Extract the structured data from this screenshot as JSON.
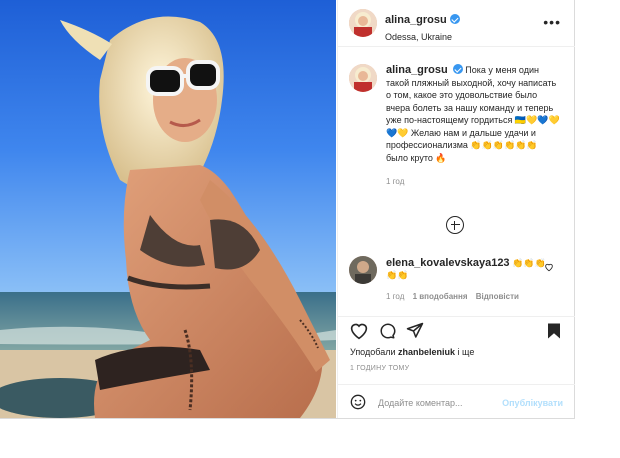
{
  "post": {
    "username": "alina_grosu",
    "location": "Odessa, Ukraine",
    "more": "•••"
  },
  "caption": {
    "text": "Пока у меня один такой пляжный выходной, хочу написать о том, какое это удовольствие было вчера болеть за нашу команду и теперь уже по-настоящему гордиться 🇺🇦💛💙💛💙💛 Желаю нам и дальше удачи и профессионализма 👏👏👏👏👏👏 было круто 🔥",
    "time": "1 год"
  },
  "comment": {
    "username": "elena_kovalevskaya123",
    "text": "👏👏👏👏👏",
    "time": "1 год",
    "likes": "1 вподобання",
    "reply": "Відповісти"
  },
  "likes": {
    "prefix": "Уподобали",
    "user": "zhanbeleniuk",
    "suffix": "і ще"
  },
  "timestamp": "1 ГОДИНУ ТОМУ",
  "add_comment": {
    "placeholder": "Додайте коментар...",
    "publish": "Опублікувати"
  },
  "icons": [
    "heart-icon",
    "comment-icon",
    "share-icon",
    "bookmark-icon",
    "smile-icon",
    "plus-circle-icon"
  ],
  "colors": {
    "link": "#3897f0",
    "muted": "#8e8e8e",
    "publish_disabled": "#b2dffc"
  }
}
